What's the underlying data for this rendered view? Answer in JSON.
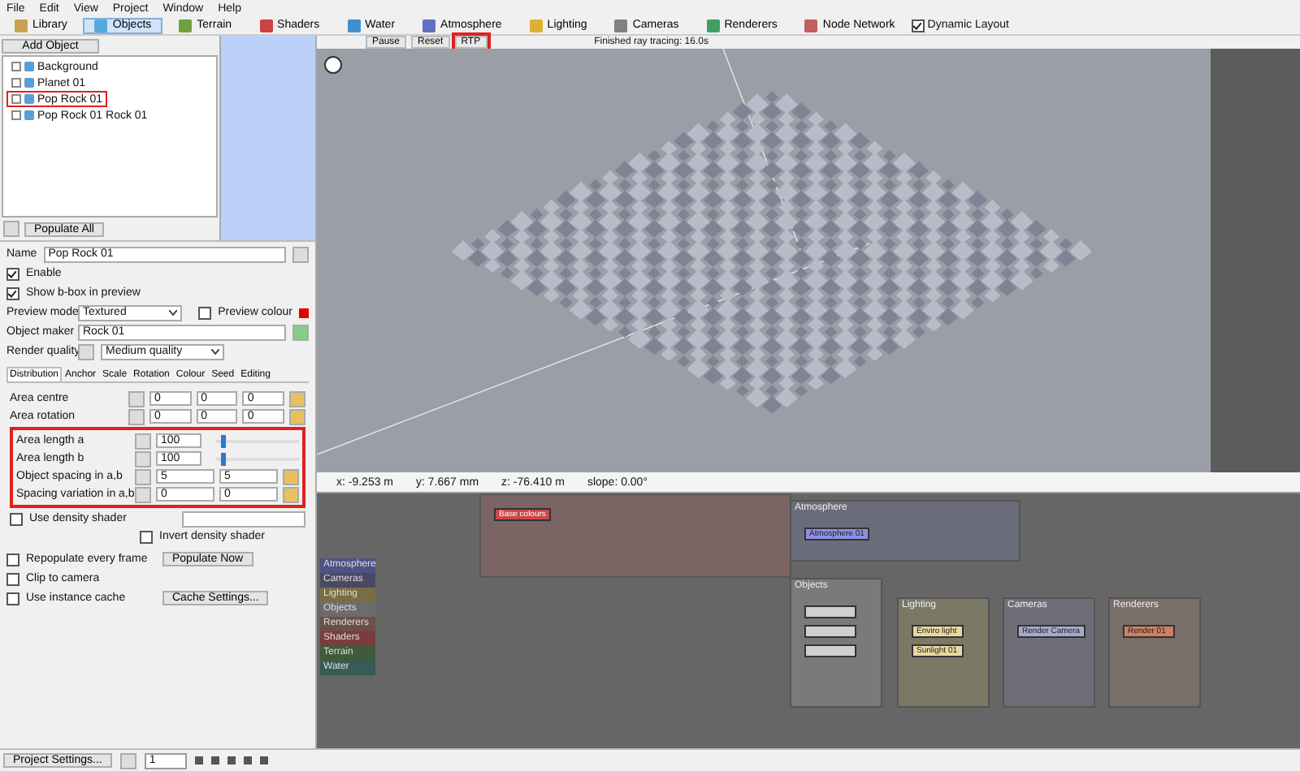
{
  "menu": [
    "File",
    "Edit",
    "View",
    "Project",
    "Window",
    "Help"
  ],
  "toolbar": {
    "tabs": [
      {
        "label": "Library",
        "selected": false
      },
      {
        "label": "Objects",
        "selected": true
      },
      {
        "label": "Terrain",
        "selected": false
      },
      {
        "label": "Shaders",
        "selected": false
      },
      {
        "label": "Water",
        "selected": false
      },
      {
        "label": "Atmosphere",
        "selected": false
      },
      {
        "label": "Lighting",
        "selected": false
      },
      {
        "label": "Cameras",
        "selected": false
      },
      {
        "label": "Renderers",
        "selected": false
      },
      {
        "label": "Node Network",
        "selected": false
      }
    ],
    "dynamic_layout": {
      "label": "Dynamic Layout",
      "checked": true
    }
  },
  "object_panel": {
    "add_button": "Add Object",
    "tree": [
      {
        "label": "Background",
        "highlighted": false
      },
      {
        "label": "Planet 01",
        "highlighted": false
      },
      {
        "label": "Pop Rock 01",
        "highlighted": true
      },
      {
        "label": "Pop Rock 01 Rock 01",
        "highlighted": false
      }
    ],
    "populate_button": "Populate All"
  },
  "properties": {
    "name_label": "Name",
    "name": "Pop Rock 01",
    "checks": [
      {
        "label": "Enable",
        "checked": true
      },
      {
        "label": "Show b-box in preview",
        "checked": true
      }
    ],
    "preview_mode_label": "Preview mode",
    "preview_mode": "Textured",
    "preview_colour": {
      "label": "Preview colour",
      "checked": false
    },
    "object_maker_label": "Object maker",
    "object_maker": "Rock 01",
    "render_quality_label": "Render quality",
    "render_quality": "Medium quality",
    "tabs": [
      {
        "label": "Distribution",
        "selected": true
      },
      {
        "label": "Anchor",
        "selected": false
      },
      {
        "label": "Scale",
        "selected": false
      },
      {
        "label": "Rotation",
        "selected": false
      },
      {
        "label": "Colour",
        "selected": false
      },
      {
        "label": "Seed",
        "selected": false
      },
      {
        "label": "Editing",
        "selected": false
      }
    ],
    "rows": [
      {
        "kind": "triple",
        "label": "Area centre",
        "values": [
          "0",
          "0",
          "0"
        ]
      },
      {
        "kind": "triple",
        "label": "Area rotation",
        "values": [
          "0",
          "0",
          "0"
        ]
      }
    ],
    "highlighted_rows": [
      {
        "kind": "slider",
        "label": "Area length a",
        "values": [
          "100"
        ],
        "level": 0.05
      },
      {
        "kind": "slider",
        "label": "Area length b",
        "values": [
          "100"
        ],
        "level": 0.05
      },
      {
        "kind": "pair",
        "label": "Object spacing in a,b",
        "values": [
          "5",
          "5"
        ]
      },
      {
        "kind": "pair",
        "label": "Spacing variation in a,b",
        "values": [
          "0",
          "0"
        ]
      }
    ],
    "density": {
      "label": "Use density shader",
      "checked": false
    },
    "invert": {
      "label": "Invert density shader",
      "checked": false
    },
    "options": [
      {
        "label": "Repopulate every frame",
        "checked": false,
        "button": "Populate Now"
      },
      {
        "label": "Clip to camera",
        "checked": false
      },
      {
        "label": "Use instance cache",
        "checked": false,
        "button": "Cache Settings..."
      }
    ]
  },
  "viewport": {
    "buttons": [
      {
        "label": "Pause",
        "highlighted": false
      },
      {
        "label": "Reset",
        "highlighted": false
      },
      {
        "label": "RTP",
        "highlighted": true
      }
    ],
    "status": "Finished ray tracing: 16.0s",
    "coords": [
      "x: -9.253 m",
      "y: 7.667 mm",
      "z: -76.410 m",
      "slope: 0.00°"
    ]
  },
  "node_network": {
    "categories": [
      {
        "label": "Atmosphere",
        "color": "#4d5286"
      },
      {
        "label": "Cameras",
        "color": "#4a4862"
      },
      {
        "label": "Lighting",
        "color": "#786e42"
      },
      {
        "label": "Objects",
        "color": "#6c6c6c"
      },
      {
        "label": "Renderers",
        "color": "#6a4f4a"
      },
      {
        "label": "Shaders",
        "color": "#7a3c3c"
      },
      {
        "label": "Terrain",
        "color": "#3f5b3b"
      },
      {
        "label": "Water",
        "color": "#375b56"
      }
    ],
    "groups": [
      {
        "kind": "shaders",
        "nodes": [
          {
            "label": "Base colours"
          }
        ]
      },
      {
        "kind": "atmosphere",
        "title": "Atmosphere",
        "nodes": [
          {
            "label": "Atmosphere 01"
          }
        ]
      },
      {
        "kind": "objects",
        "title": "Objects"
      },
      {
        "kind": "lighting",
        "title": "Lighting",
        "nodes": [
          {
            "label": "Enviro light"
          },
          {
            "label": "Sunlight 01"
          }
        ]
      },
      {
        "kind": "cameras",
        "title": "Cameras",
        "nodes": [
          {
            "label": "Render Camera"
          }
        ]
      },
      {
        "kind": "renderers",
        "title": "Renderers",
        "nodes": [
          {
            "label": "Render 01"
          }
        ]
      }
    ]
  },
  "status_bar": {
    "project_button": "Project Settings...",
    "frame": "1"
  }
}
